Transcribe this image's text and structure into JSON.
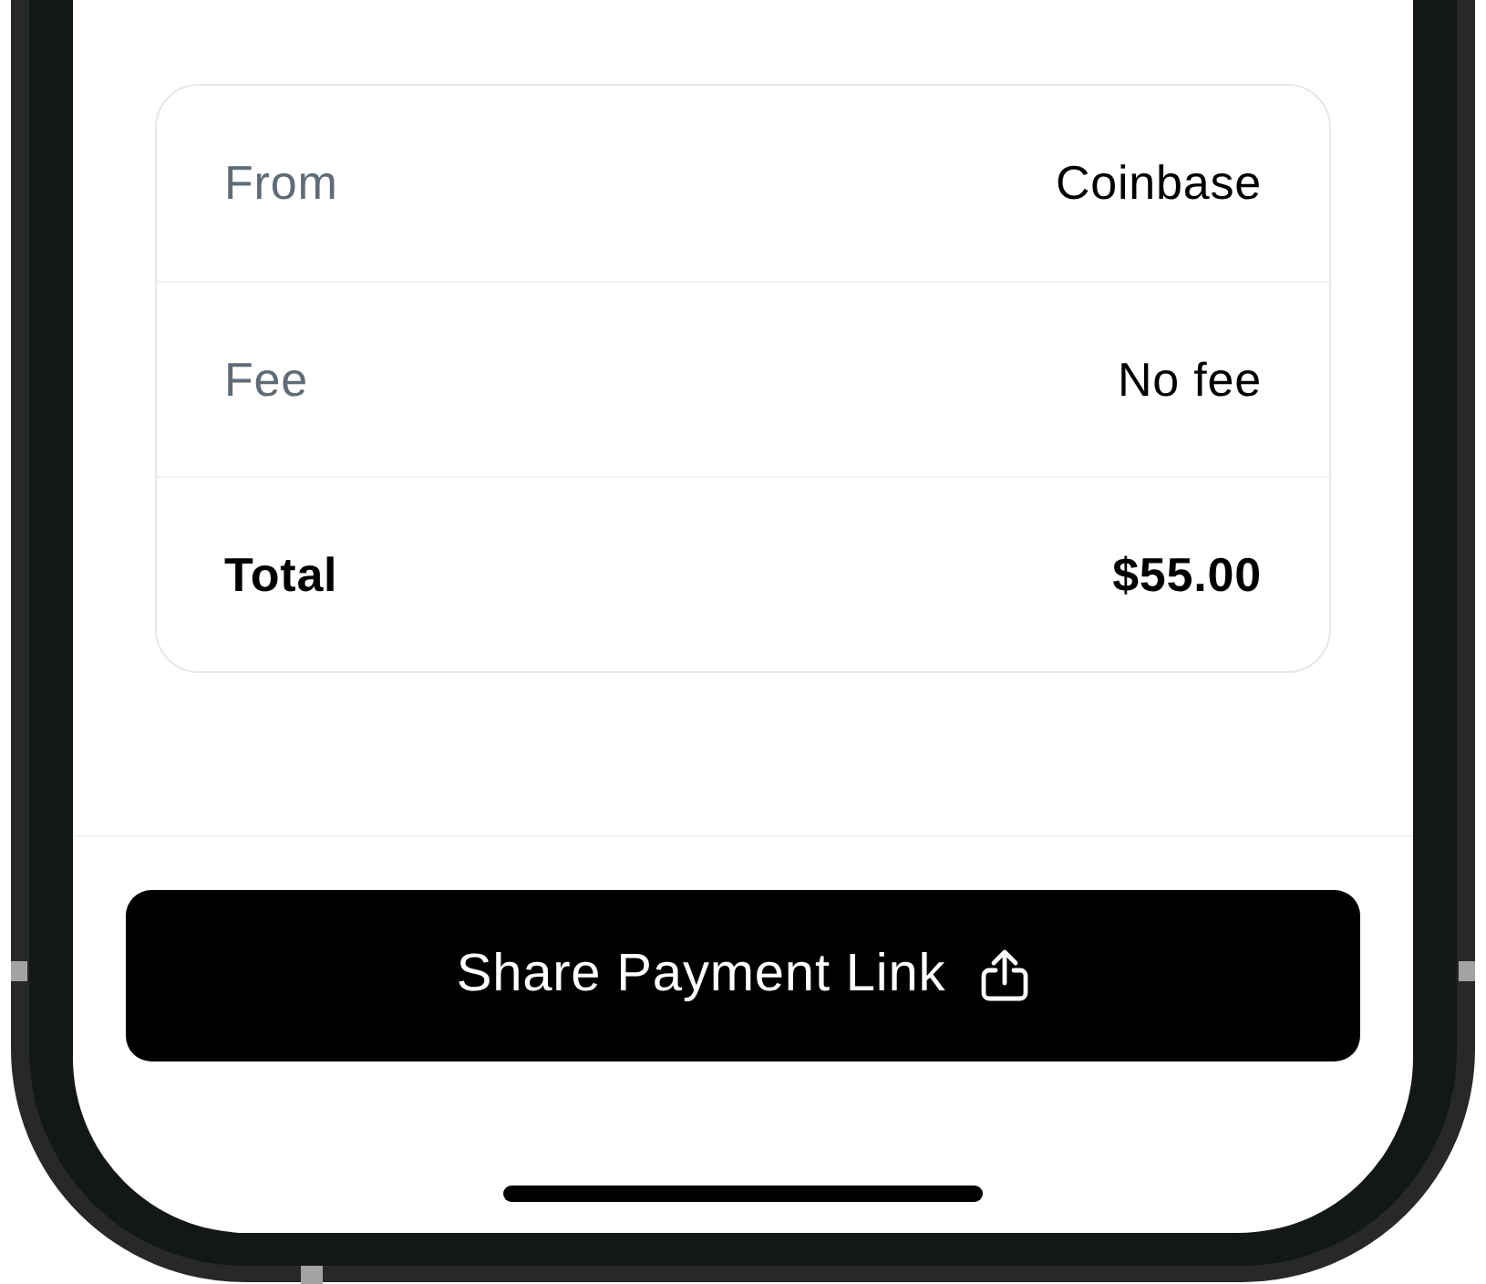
{
  "summary": {
    "rows": [
      {
        "kind": "detail",
        "label": "From",
        "value": "Coinbase"
      },
      {
        "kind": "detail",
        "label": "Fee",
        "value": "No fee"
      },
      {
        "kind": "total",
        "label": "Total",
        "value": "$55.00"
      }
    ]
  },
  "share_button": {
    "label": "Share Payment Link"
  }
}
